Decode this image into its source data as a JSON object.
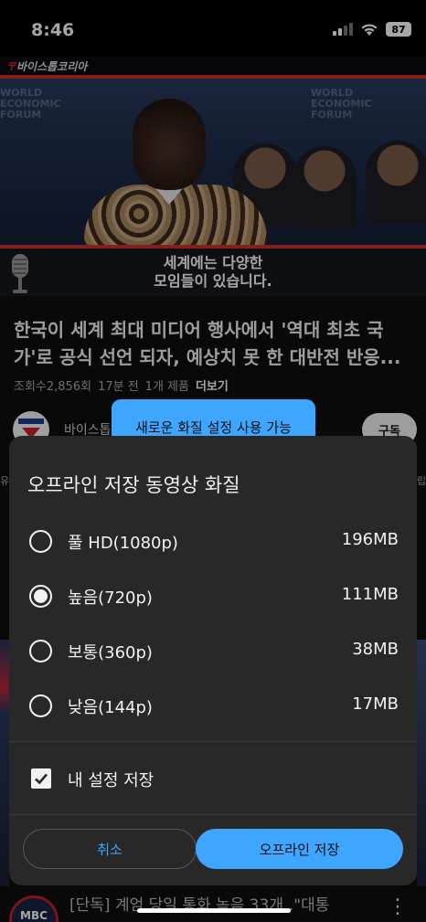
{
  "status_bar": {
    "time": "8:46",
    "battery": "87"
  },
  "video": {
    "channel_watermark": "바이스톱코리아",
    "background_text": "WORLD ECONOMIC FORUM",
    "caption_line1": "세계에는 다양한",
    "caption_line2": "모임들이 있습니다."
  },
  "video_info": {
    "title": "한국이 세계 최대 미디어 행사에서 '역대 최초 국가'로 공식 선언 되자, 예상치 못 한 대반전 반응...",
    "views": "조회수2,856회",
    "age": "17분 전",
    "products": "1개 제품",
    "more": "더보기",
    "channel_name": "바이스톱",
    "subscribe": "구독",
    "edge_left": "유",
    "edge_right": "립"
  },
  "tooltip": {
    "text": "새로운 화질 설정 사용 가능"
  },
  "dialog": {
    "title": "오프라인 저장 동영상 화질",
    "options": [
      {
        "label": "풀 HD(1080p)",
        "size": "196MB",
        "selected": false
      },
      {
        "label": "높음(720p)",
        "size": "111MB",
        "selected": true
      },
      {
        "label": "보통(360p)",
        "size": "38MB",
        "selected": false
      },
      {
        "label": "낮음(144p)",
        "size": "17MB",
        "selected": false
      }
    ],
    "remember_label": "내 설정 저장",
    "remember_checked": true,
    "cancel_label": "취소",
    "save_label": "오프라인 저장"
  },
  "next_video": {
    "channel_logo": "MBC",
    "title": "[단독] 계엄 당일 통화 녹음 33개‥\"대통"
  },
  "colors": {
    "accent": "#3ea6ff",
    "dialog_bg": "#282828",
    "page_bg": "#0f0f0f"
  }
}
